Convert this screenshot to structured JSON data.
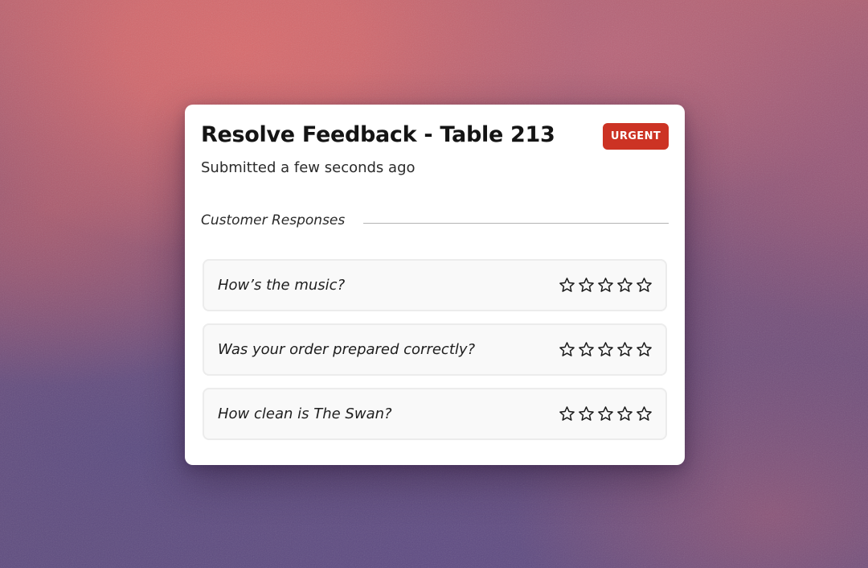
{
  "card": {
    "title": "Resolve Feedback - Table 213",
    "badge": "URGENT",
    "subtitle": "Submitted a few seconds ago",
    "section_label": "Customer Responses"
  },
  "questions": [
    {
      "text": "How’s the music?",
      "rating": 0,
      "max_rating": 5
    },
    {
      "text": "Was your order prepared correctly?",
      "rating": 0,
      "max_rating": 5
    },
    {
      "text": "How clean is The Swan?",
      "rating": 0,
      "max_rating": 5
    }
  ],
  "icons": {
    "rating": "star-outline-icon"
  },
  "colors": {
    "badge_background": "#cc3324",
    "badge_text": "#ffffff",
    "card_background": "#ffffff",
    "star_stroke": "#1a1a1a"
  }
}
